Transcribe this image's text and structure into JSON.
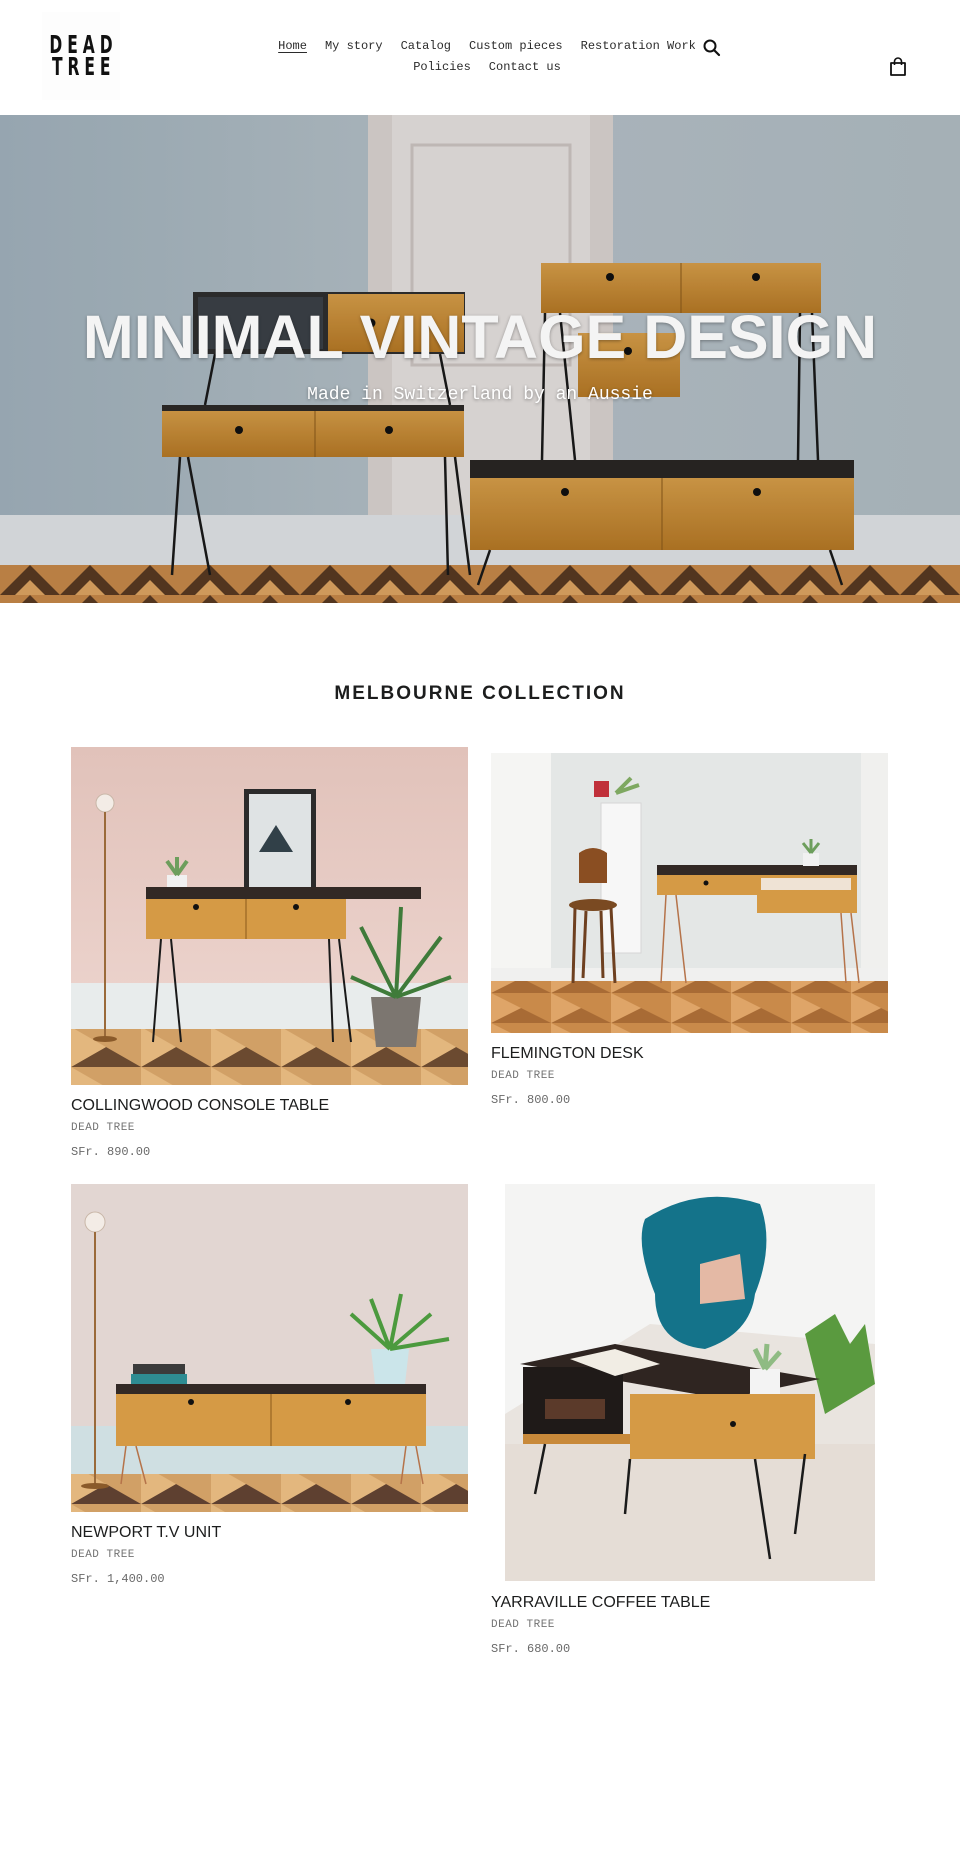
{
  "header": {
    "logo_line1": "DEAD",
    "logo_line2": "TREE",
    "nav_row1": [
      {
        "label": "Home",
        "active": true
      },
      {
        "label": "My story",
        "active": false
      },
      {
        "label": "Catalog",
        "active": false
      },
      {
        "label": "Custom pieces",
        "active": false
      },
      {
        "label": "Restoration Work",
        "active": false
      }
    ],
    "nav_row2": [
      {
        "label": "Policies",
        "active": false
      },
      {
        "label": "Contact us",
        "active": false
      }
    ],
    "search_icon": "search-icon",
    "cart_icon": "shopping-bag-icon"
  },
  "hero": {
    "title": "MINIMAL VINTAGE DESIGN",
    "subtitle": "Made in Switzerland by an Aussie"
  },
  "collection": {
    "title": "MELBOURNE COLLECTION",
    "products": [
      {
        "title": "COLLINGWOOD CONSOLE TABLE",
        "vendor": "DEAD TREE",
        "price": "SFr. 890.00"
      },
      {
        "title": "FLEMINGTON DESK",
        "vendor": "DEAD TREE",
        "price": "SFr. 800.00"
      },
      {
        "title": "NEWPORT T.V UNIT",
        "vendor": "DEAD TREE",
        "price": "SFr. 1,400.00"
      },
      {
        "title": "YARRAVILLE COFFEE TABLE",
        "vendor": "DEAD TREE",
        "price": "SFr. 680.00"
      }
    ]
  },
  "colors": {
    "text": "#1c1d1d",
    "muted": "#737373",
    "wall_blue": "#a9b8c2",
    "wood": "#c98a2c"
  }
}
